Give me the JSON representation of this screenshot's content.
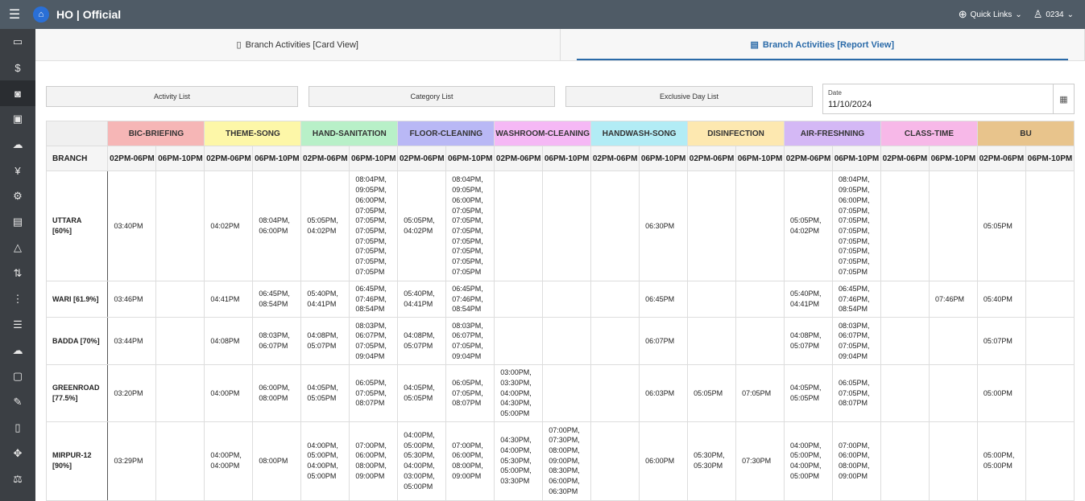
{
  "header": {
    "title": "HO | Official",
    "quick_links": "Quick Links",
    "user": "0234"
  },
  "sidebar": {
    "icons": [
      "card-icon",
      "dollar-icon",
      "camera-icon",
      "cash-icon",
      "cloud-icon",
      "yen-icon",
      "gear-icon",
      "dashboard-icon",
      "warning-icon",
      "transfer-icon",
      "more-icon",
      "list-icon",
      "cloud-sync-icon",
      "message-icon",
      "edit-icon",
      "document-icon",
      "move-icon",
      "scale-icon"
    ]
  },
  "tabs": [
    {
      "label": "Branch Activities [Card View]"
    },
    {
      "label": "Branch Activities [Report View]"
    }
  ],
  "filters": {
    "activity": "Activity List",
    "category": "Category List",
    "exclusive": "Exclusive Day List",
    "date_label": "Date",
    "date_value": "11/10/2024"
  },
  "colors": {
    "header_bg": "#4f5b66",
    "sidebar_bg": "#3b3f44",
    "accent": "#2a6aa8"
  },
  "table": {
    "branch_header": "BRANCH",
    "activities": [
      {
        "name": "BIC-BRIEFING",
        "color": "#f6b6b6"
      },
      {
        "name": "THEME-SONG",
        "color": "#fdf7a8"
      },
      {
        "name": "HAND-SANITATION",
        "color": "#b8f0c8"
      },
      {
        "name": "FLOOR-CLEANING",
        "color": "#b9b8f5"
      },
      {
        "name": "WASHROOM-CLEANING",
        "color": "#f5b8f5"
      },
      {
        "name": "HANDWASH-SONG",
        "color": "#b2ecf5"
      },
      {
        "name": "DISINFECTION",
        "color": "#fde8b0"
      },
      {
        "name": "AIR-FRESHNING",
        "color": "#d4b8f5"
      },
      {
        "name": "CLASS-TIME",
        "color": "#f7b8e8"
      },
      {
        "name": "BU",
        "color": "#e8c48c"
      }
    ],
    "slots": [
      "02PM-06PM",
      "06PM-10PM"
    ],
    "rows": [
      {
        "branch": "UTTARA\n[60%]",
        "cells": [
          "03:40PM",
          "",
          "04:02PM",
          "08:04PM,\n06:00PM",
          "05:05PM,\n04:02PM",
          "08:04PM,\n09:05PM,\n06:00PM,\n07:05PM,\n07:05PM,\n07:05PM,\n07:05PM,\n07:05PM,\n07:05PM,\n07:05PM",
          "05:05PM,\n04:02PM",
          "08:04PM,\n09:05PM,\n06:00PM,\n07:05PM,\n07:05PM,\n07:05PM,\n07:05PM,\n07:05PM,\n07:05PM,\n07:05PM",
          "",
          "",
          "",
          "06:30PM",
          "",
          "",
          "05:05PM,\n04:02PM",
          "08:04PM,\n09:05PM,\n06:00PM,\n07:05PM,\n07:05PM,\n07:05PM,\n07:05PM,\n07:05PM,\n07:05PM,\n07:05PM",
          "",
          "",
          "05:05PM"
        ]
      },
      {
        "branch": "WARI [61.9%]",
        "cells": [
          "03:46PM",
          "",
          "04:41PM",
          "06:45PM,\n08:54PM",
          "05:40PM,\n04:41PM",
          "06:45PM,\n07:46PM,\n08:54PM",
          "05:40PM,\n04:41PM",
          "06:45PM,\n07:46PM,\n08:54PM",
          "",
          "",
          "",
          "06:45PM",
          "",
          "",
          "05:40PM,\n04:41PM",
          "06:45PM,\n07:46PM,\n08:54PM",
          "",
          "07:46PM",
          "05:40PM"
        ]
      },
      {
        "branch": "BADDA [70%]",
        "cells": [
          "03:44PM",
          "",
          "04:08PM",
          "08:03PM,\n06:07PM",
          "04:08PM,\n05:07PM",
          "08:03PM,\n06:07PM,\n07:05PM,\n09:04PM",
          "04:08PM,\n05:07PM",
          "08:03PM,\n06:07PM,\n07:05PM,\n09:04PM",
          "",
          "",
          "",
          "06:07PM",
          "",
          "",
          "04:08PM,\n05:07PM",
          "08:03PM,\n06:07PM,\n07:05PM,\n09:04PM",
          "",
          "",
          "05:07PM"
        ]
      },
      {
        "branch": "GREENROAD\n[77.5%]",
        "cells": [
          "03:20PM",
          "",
          "04:00PM",
          "06:00PM,\n08:00PM",
          "04:05PM,\n05:05PM",
          "06:05PM,\n07:05PM,\n08:07PM",
          "04:05PM,\n05:05PM",
          "06:05PM,\n07:05PM,\n08:07PM",
          "03:00PM,\n03:30PM,\n04:00PM,\n04:30PM,\n05:00PM",
          "",
          "",
          "06:03PM",
          "05:05PM",
          "07:05PM",
          "04:05PM,\n05:05PM",
          "06:05PM,\n07:05PM,\n08:07PM",
          "",
          "",
          "05:00PM"
        ]
      },
      {
        "branch": "MIRPUR-12\n[90%]",
        "cells": [
          "03:29PM",
          "",
          "04:00PM,\n04:00PM",
          "08:00PM",
          "04:00PM,\n05:00PM,\n04:00PM,\n05:00PM",
          "07:00PM,\n06:00PM,\n08:00PM,\n09:00PM",
          "04:00PM,\n05:00PM,\n05:30PM,\n04:00PM,\n03:00PM,\n05:00PM",
          "07:00PM,\n06:00PM,\n08:00PM,\n09:00PM",
          "04:30PM,\n04:00PM,\n05:30PM,\n05:00PM,\n03:30PM",
          "07:00PM,\n07:30PM,\n08:00PM,\n09:00PM,\n08:30PM,\n06:00PM,\n06:30PM",
          "",
          "06:00PM",
          "05:30PM,\n05:30PM",
          "07:30PM",
          "04:00PM,\n05:00PM,\n04:00PM,\n05:00PM",
          "07:00PM,\n06:00PM,\n08:00PM,\n09:00PM",
          "",
          "",
          "05:00PM,\n05:00PM"
        ]
      }
    ]
  }
}
